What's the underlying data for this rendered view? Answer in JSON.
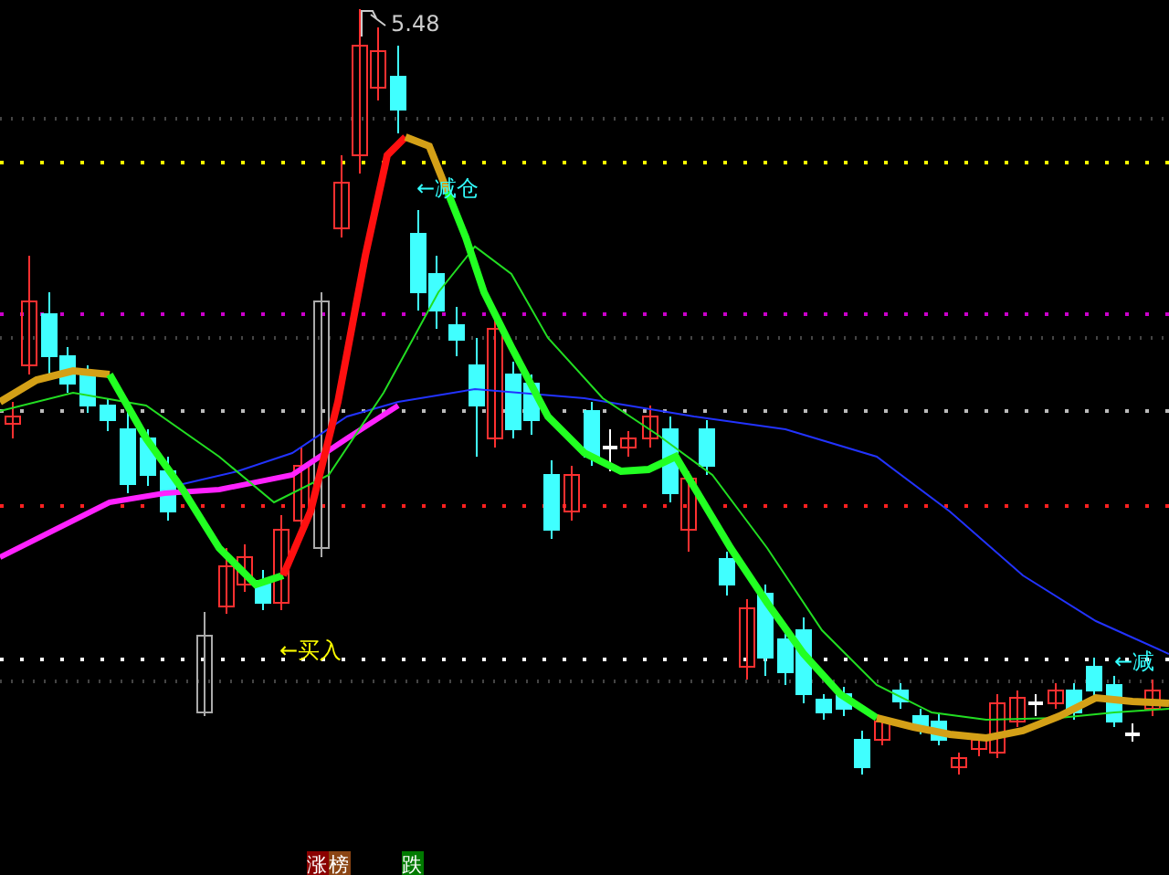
{
  "price_marker": {
    "label": "5.48"
  },
  "signals": [
    {
      "kind": "sell",
      "text": "←减仓"
    },
    {
      "kind": "buy",
      "text": "←买入"
    },
    {
      "kind": "sell",
      "text": "←减"
    }
  ],
  "legend": [
    {
      "text": "涨",
      "color": "#8b0000"
    },
    {
      "text": "榜",
      "color": "#8b4513"
    },
    {
      "text": "跌",
      "color": "#007a00"
    }
  ]
}
